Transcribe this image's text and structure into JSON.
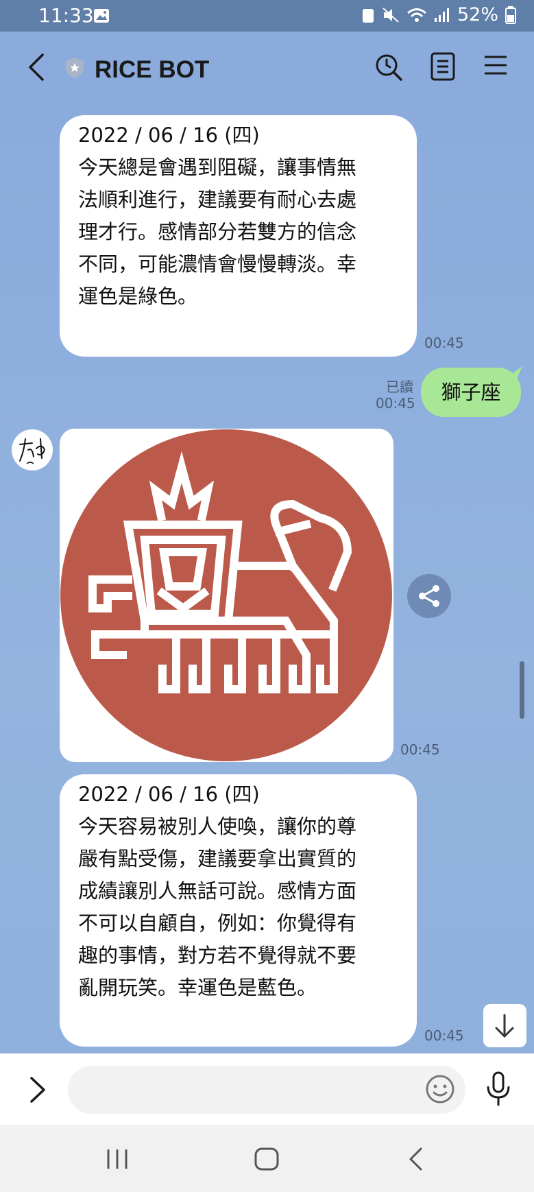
{
  "status_bar": {
    "time": "11:33",
    "battery": "52%"
  },
  "header": {
    "title": "RICE BOT"
  },
  "messages": [
    {
      "date": "2022 / 06 / 16 (四)",
      "text": "今天總是會遇到阻礙，讓事情無\n法順利進行，建議要有耐心去處\n理才行。感情部分若雙方的信念\n不同，可能濃情會慢慢轉淡。幸\n運色是綠色。",
      "time": "00:45"
    },
    {
      "read_label": "已讀",
      "time": "00:45",
      "text": "獅子座"
    },
    {
      "image_icon": "leo-zodiac-icon",
      "time": "00:45"
    },
    {
      "date": "2022 / 06 / 16 (四)",
      "text": "今天容易被別人使喚，讓你的尊\n嚴有點受傷，建議要拿出實質的\n成績讓別人無話可說。感情方面\n不可以自顧自，例如：你覺得有\n趣的事情，對方若不覺得就不要\n亂開玩笑。幸運色是藍色。",
      "time": "00:45"
    }
  ],
  "colors": {
    "chat_bg": "#8aabdc",
    "user_bubble": "#a7e796",
    "leo_circle": "#bb5a4a"
  }
}
